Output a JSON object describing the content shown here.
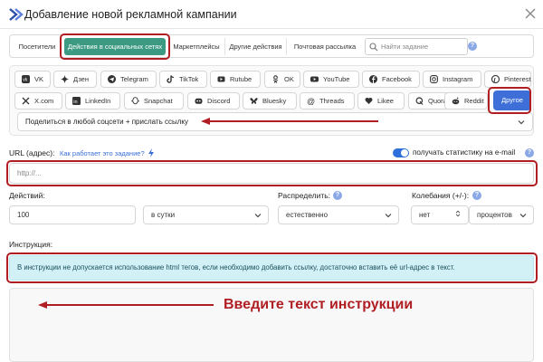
{
  "header": {
    "title": "Добавление новой рекламной кампании"
  },
  "tabs": [
    {
      "label": "Посетители",
      "active": false
    },
    {
      "label": "Действия в социальных сетях",
      "active": true
    },
    {
      "label": "Маркетплейсы",
      "active": false
    },
    {
      "label": "Другие действия",
      "active": false
    },
    {
      "label": "Почтовая рассылка",
      "active": false
    }
  ],
  "search": {
    "placeholder": "Найти задание"
  },
  "social_row1": [
    {
      "label": "VK",
      "icon": "vk-icon"
    },
    {
      "label": "Дзен",
      "icon": "dzen-icon"
    },
    {
      "label": "Telegram",
      "icon": "telegram-icon"
    },
    {
      "label": "TikTok",
      "icon": "tiktok-icon"
    },
    {
      "label": "Rutube",
      "icon": "rutube-icon"
    },
    {
      "label": "OK",
      "icon": "ok-icon"
    },
    {
      "label": "YouTube",
      "icon": "youtube-icon"
    },
    {
      "label": "Facebook",
      "icon": "facebook-icon"
    },
    {
      "label": "Instagram",
      "icon": "instagram-icon"
    },
    {
      "label": "Pinterest",
      "icon": "pinterest-icon"
    }
  ],
  "social_row2": [
    {
      "label": "X.com",
      "icon": "x-icon"
    },
    {
      "label": "LinkedIn",
      "icon": "linkedin-icon"
    },
    {
      "label": "Snapchat",
      "icon": "snapchat-icon"
    },
    {
      "label": "Discord",
      "icon": "discord-icon"
    },
    {
      "label": "Bluesky",
      "icon": "bluesky-icon"
    },
    {
      "label": "Threads",
      "icon": "threads-icon"
    },
    {
      "label": "Likee",
      "icon": "likee-icon"
    },
    {
      "label": "Quora",
      "icon": "quora-icon"
    },
    {
      "label": "Reddit",
      "icon": "reddit-icon"
    }
  ],
  "other_button": "Другое",
  "share_select": "Поделиться в любой соцсети + прислать ссылку",
  "url": {
    "label": "URL (адрес):",
    "how_link": "Как работает это задание?",
    "placeholder": "http://..."
  },
  "email_stats": {
    "label": "получать статистику на e-mail",
    "enabled": true
  },
  "actions": {
    "label": "Действий:",
    "value": "100",
    "period": "в сутки"
  },
  "distribute": {
    "label": "Распределить:",
    "value": "естественно"
  },
  "fluctuation": {
    "label": "Колебания (+/-):",
    "value": "нет",
    "unit": "процентов"
  },
  "instruction": {
    "label": "Инструкция:",
    "info": "В инструкции не допускается использование html тегов, если необходимо добавить ссылку, достаточно вставить её url-адрес в текст.",
    "overlay": "Введите текст инструкции"
  },
  "help_mark": "?",
  "colors": {
    "accent_green": "#3d9a82",
    "accent_blue": "#3e6fd8",
    "highlight_red": "#b01e23",
    "info_bg": "#d2f1f6"
  }
}
